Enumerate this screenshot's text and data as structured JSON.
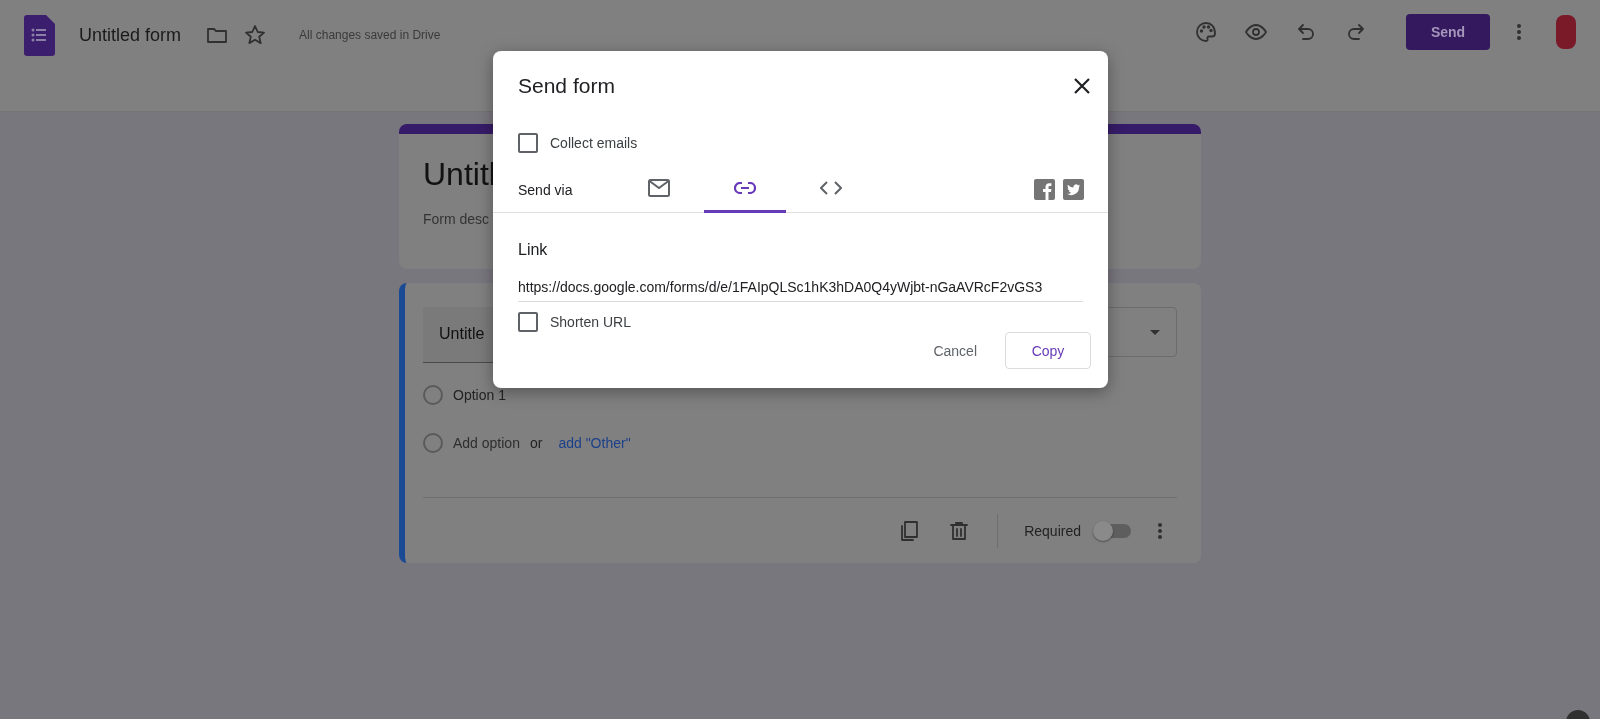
{
  "header": {
    "title": "Untitled form",
    "save_status": "All changes saved in Drive",
    "send_button": "Send"
  },
  "form_header": {
    "title": "Untitl",
    "description": "Form desc"
  },
  "question": {
    "title": "Untitle",
    "options": [
      {
        "kind": "option",
        "label": "Option 1",
        "selected": false
      },
      {
        "kind": "add",
        "label": "Add option",
        "selected": false,
        "joiner": "or",
        "link": "add \"Other\""
      }
    ],
    "required": {
      "label": "Required",
      "on": false
    }
  },
  "dialog": {
    "title": "Send form",
    "collect_emails": {
      "label": "Collect emails",
      "checked": false
    },
    "send_via": "Send via",
    "tabs": [
      {
        "kind": "email",
        "selected": false
      },
      {
        "kind": "link",
        "selected": true
      },
      {
        "kind": "embed",
        "selected": false
      }
    ],
    "link_label": "Link",
    "url": "https://docs.google.com/forms/d/e/1FAIpQLSc1hK3hDA0Q4yWjbt-nGaAVRcF2vGS3",
    "shorten_url": {
      "label": "Shorten URL",
      "checked": false
    },
    "buttons": {
      "cancel": "Cancel",
      "copy": "Copy"
    }
  }
}
